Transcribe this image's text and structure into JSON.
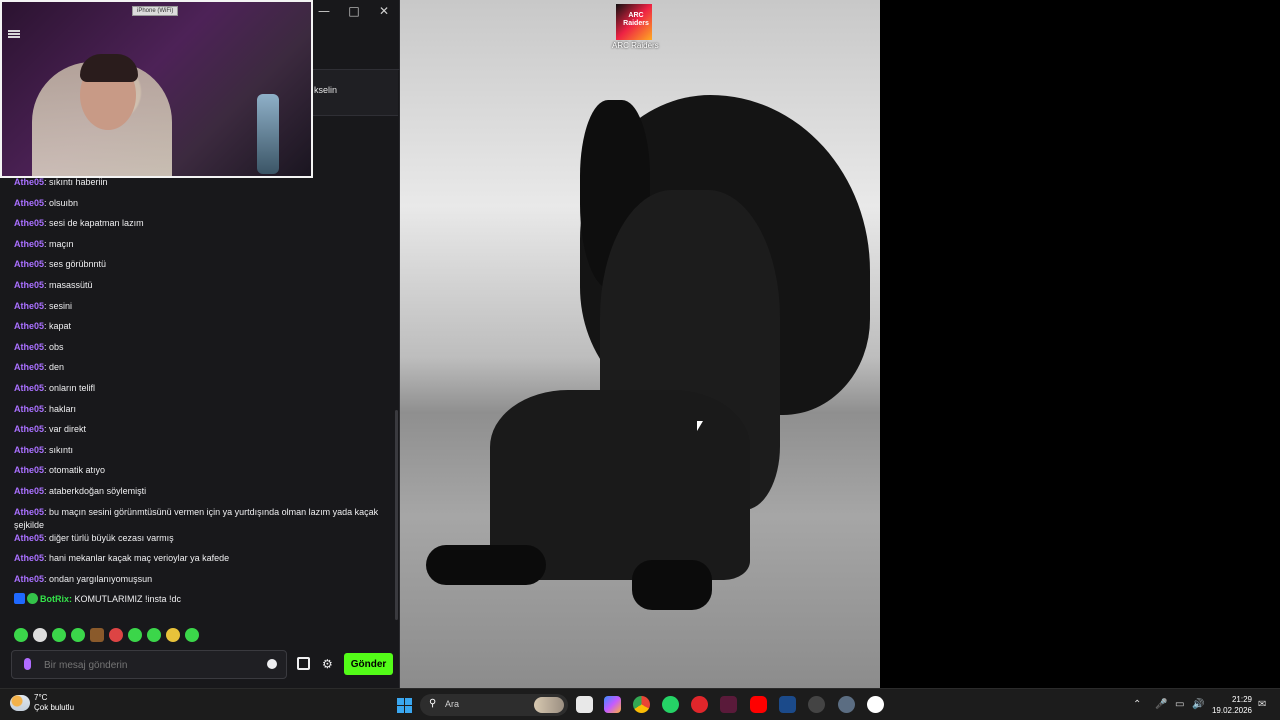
{
  "webcam": {
    "device_label": "iPhone (WiFi)"
  },
  "pinned": {
    "text": "kselin"
  },
  "chat": {
    "messages": [
      {
        "user": "Athe05",
        "text": ": sıkıntı haberiin"
      },
      {
        "user": "Athe05",
        "text": ": olsuıbn"
      },
      {
        "user": "Athe05",
        "text": ": sesi de kapatman lazım"
      },
      {
        "user": "Athe05",
        "text": ": maçın"
      },
      {
        "user": "Athe05",
        "text": ": ses görübnntü"
      },
      {
        "user": "Athe05",
        "text": ": masassütü"
      },
      {
        "user": "Athe05",
        "text": ": sesini"
      },
      {
        "user": "Athe05",
        "text": ": kapat"
      },
      {
        "user": "Athe05",
        "text": ": obs"
      },
      {
        "user": "Athe05",
        "text": ": den"
      },
      {
        "user": "Athe05",
        "text": ": onların telifl"
      },
      {
        "user": "Athe05",
        "text": ": hakları"
      },
      {
        "user": "Athe05",
        "text": ": var direkt"
      },
      {
        "user": "Athe05",
        "text": ": sıkıntı"
      },
      {
        "user": "Athe05",
        "text": ": otomatik atıyo"
      },
      {
        "user": "Athe05",
        "text": ": ataberkdoğan söylemişti"
      },
      {
        "user": "Athe05",
        "text": ": bu maçın sesini görünmtüsünü vermen için ya yurtdışında olman lazım yada kaçak şejkilde"
      },
      {
        "user": "Athe05",
        "text": ": diğer türlü büyük cezası varmış"
      },
      {
        "user": "Athe05",
        "text": ": hani mekanlar kaçak maç verioylar ya kafede"
      },
      {
        "user": "Athe05",
        "text": ": ondan yargılanıyomuşsun"
      }
    ],
    "bot_message": {
      "user": "BotRix:",
      "text": " KOMUTLARIMIZ !insta !dc"
    },
    "input_placeholder": "Bir mesaj gönderin",
    "send_label": "Gönder",
    "colors": {
      "username": "#a970ff",
      "bot": "#34e34a",
      "send": "#53fc18"
    }
  },
  "desktop": {
    "icon_label": "ARC Raiders",
    "icon_title": "ARC Raiders"
  },
  "taskbar": {
    "temperature": "7°C",
    "weather": "Çok bulutlu",
    "search_placeholder": "Ara",
    "time": "21:29",
    "date": "19.02.2026"
  }
}
